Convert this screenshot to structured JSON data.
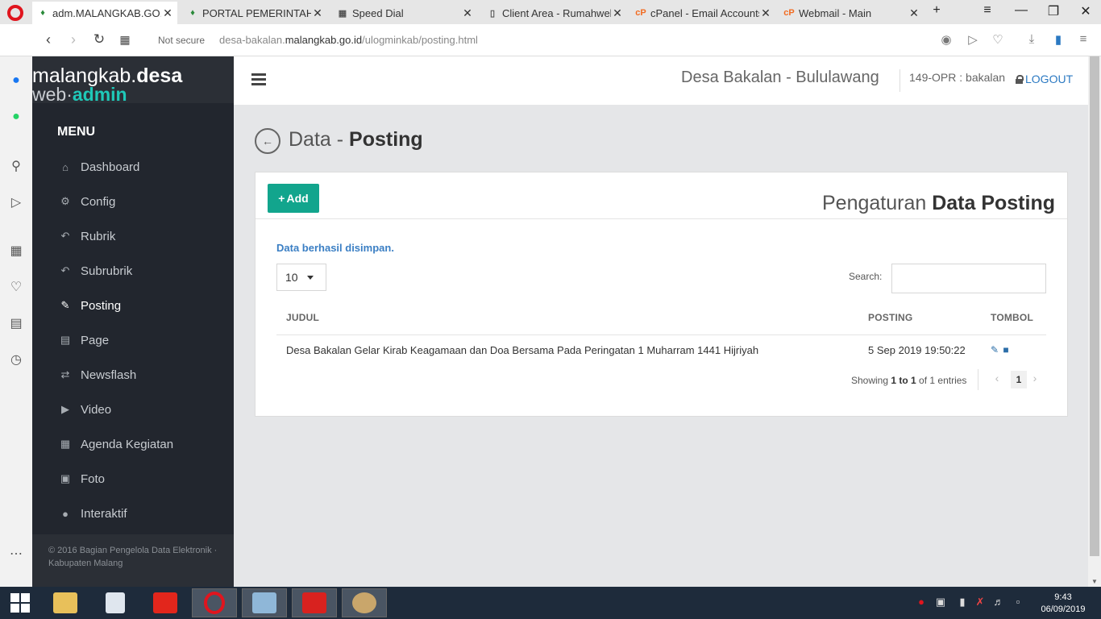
{
  "browser": {
    "tabs": [
      {
        "label": "adm.MALANGKAB.GO.ID",
        "icon": "site-favicon"
      },
      {
        "label": "PORTAL PEMERINTAH K",
        "icon": "site-favicon"
      },
      {
        "label": "Speed Dial",
        "icon": "speed-dial-icon"
      },
      {
        "label": "Client Area - Rumahweb",
        "icon": "document-icon"
      },
      {
        "label": "cPanel - Email Accounts",
        "icon": "cpanel-icon"
      },
      {
        "label": "Webmail - Main",
        "icon": "cpanel-icon"
      }
    ],
    "security": "Not secure",
    "url_prefix": "desa-bakalan.",
    "url_host": "malangkab.go.id",
    "url_path": "/ulogminkab/posting.html"
  },
  "brand": {
    "line1_a": "malangkab.",
    "line1_b": "desa",
    "line2_a": "web·",
    "line2_b": "admin"
  },
  "sidebar": {
    "menu_title": "MENU",
    "items": [
      {
        "label": "Dashboard",
        "icon": "home-icon"
      },
      {
        "label": "Config",
        "icon": "gear-icon"
      },
      {
        "label": "Rubrik",
        "icon": "reply-icon"
      },
      {
        "label": "Subrubrik",
        "icon": "reply-all-icon"
      },
      {
        "label": "Posting",
        "icon": "edit-icon",
        "active": true
      },
      {
        "label": "Page",
        "icon": "book-icon"
      },
      {
        "label": "Newsflash",
        "icon": "random-icon"
      },
      {
        "label": "Video",
        "icon": "video-icon"
      },
      {
        "label": "Agenda Kegiatan",
        "icon": "calendar-icon"
      },
      {
        "label": "Foto",
        "icon": "picture-icon"
      },
      {
        "label": "Interaktif",
        "icon": "comments-icon"
      }
    ],
    "footer": "© 2016 Bagian Pengelola Data Elektronik · Kabupaten Malang"
  },
  "topbar": {
    "desa": "Desa Bakalan - Bululawang",
    "user": "149-OPR : bakalan",
    "logout": "LOGOUT"
  },
  "page": {
    "heading_a": "Data - ",
    "heading_b": "Posting"
  },
  "panel": {
    "add_label": "Add",
    "title_a": "Pengaturan ",
    "title_b": "Data Posting",
    "success": "Data berhasil disimpan.",
    "page_length": "10",
    "search_label": "Search:",
    "search_value": "",
    "columns": [
      "JUDUL",
      "POSTING",
      "TOMBOL"
    ],
    "rows": [
      {
        "judul": "Desa Bakalan Gelar Kirab Keagamaan dan Doa Bersama Pada Peringatan 1 Muharram 1441 Hijriyah",
        "posting": "5 Sep 2019 19:50:22"
      }
    ],
    "showing_a": "Showing ",
    "showing_b": "1 to 1",
    "showing_c": " of 1 entries",
    "current_page": "1"
  },
  "taskbar": {
    "time": "9:43",
    "date": "06/09/2019"
  },
  "colors": {
    "accent": "#12a58d",
    "link": "#2b79c2",
    "sidebar_bg": "#22262e",
    "brand_teal": "#1fc8b8"
  }
}
